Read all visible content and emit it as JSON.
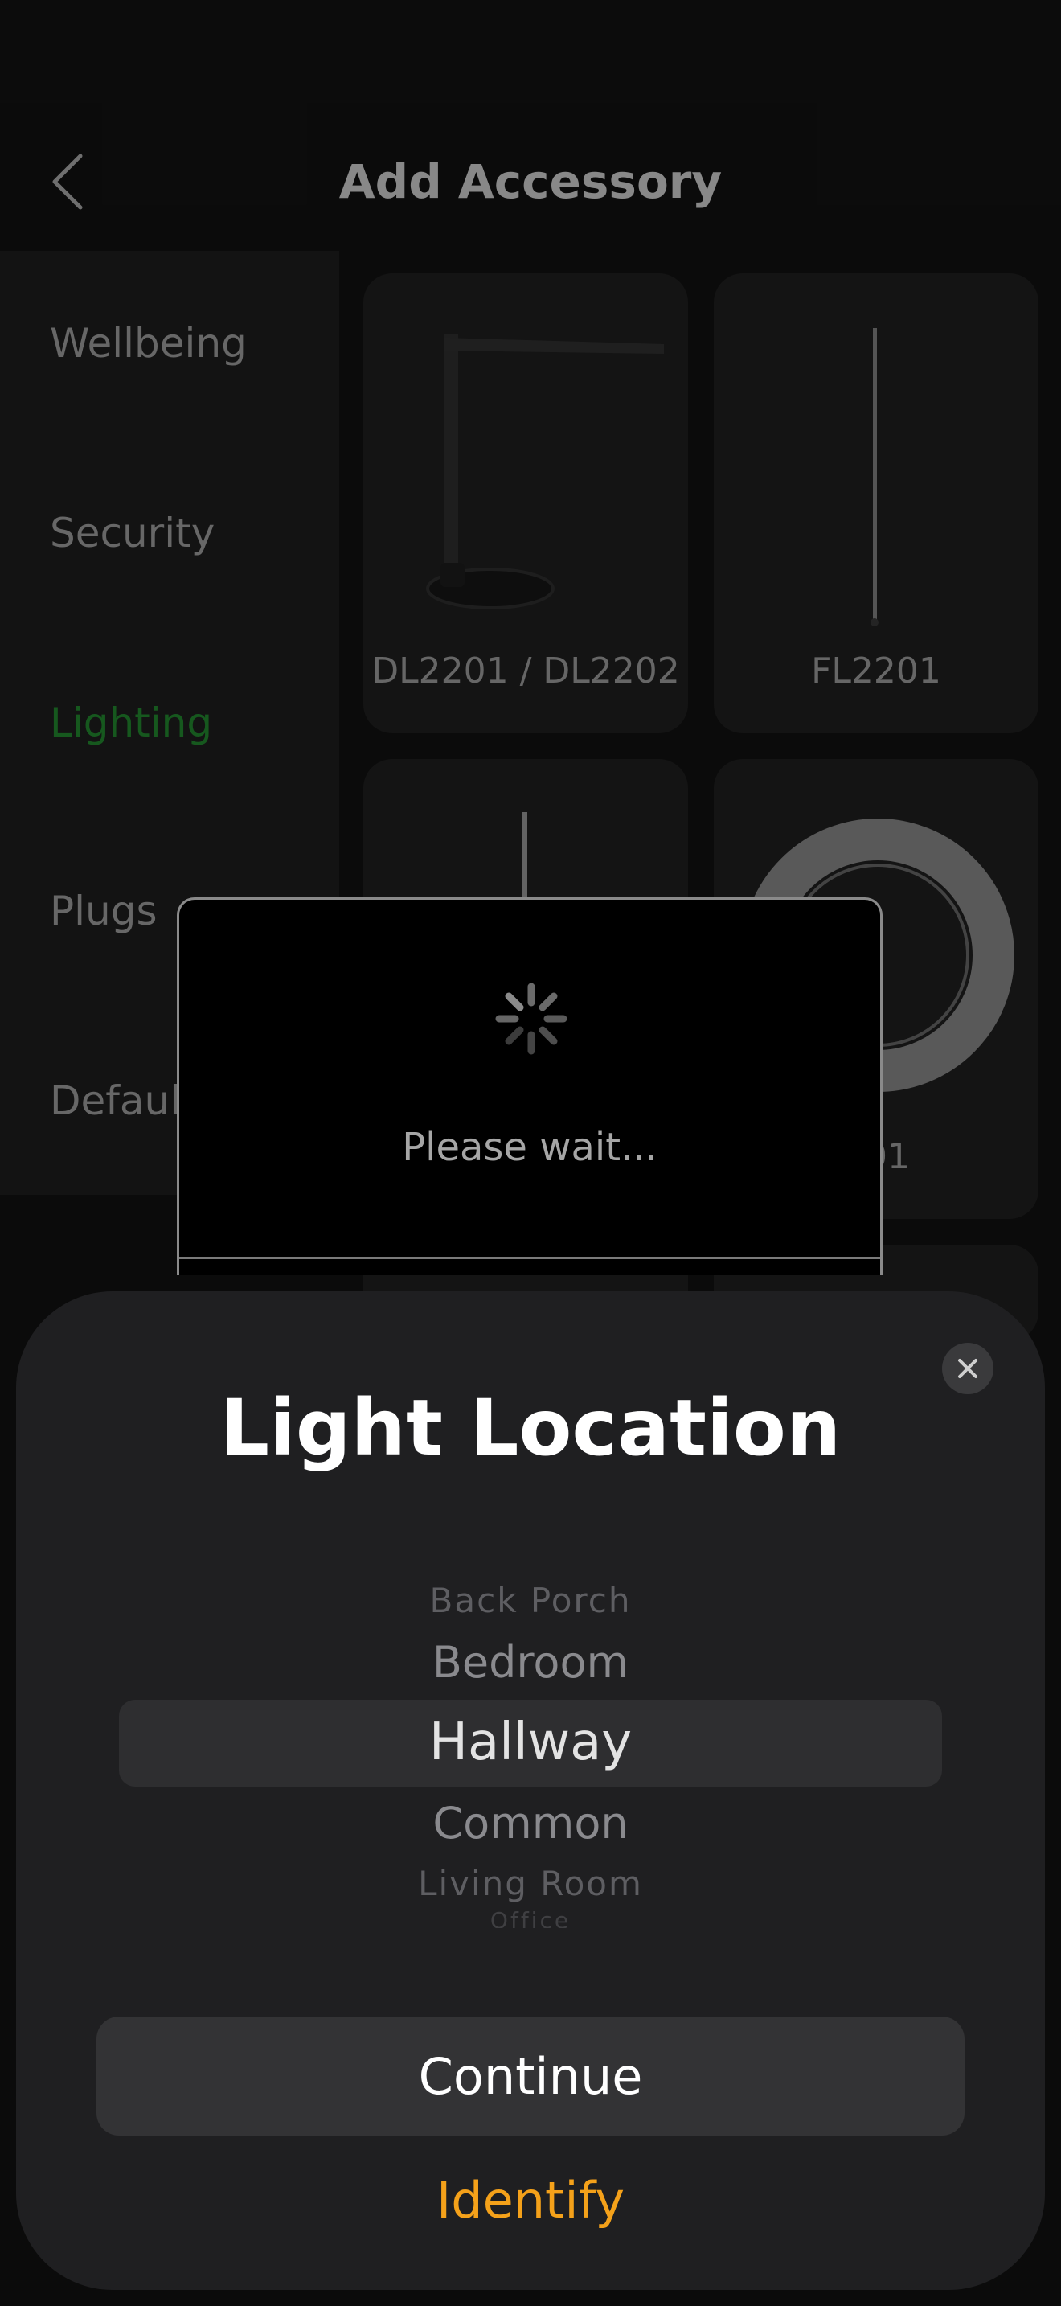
{
  "header": {
    "title": "Add Accessory",
    "back_icon": "chevron-left-icon"
  },
  "sidebar": {
    "items": [
      {
        "label": "Wellbeing",
        "active": false
      },
      {
        "label": "Security",
        "active": false
      },
      {
        "label": "Lighting",
        "active": true
      },
      {
        "label": "Plugs",
        "active": false
      },
      {
        "label": "Default",
        "active": false
      }
    ]
  },
  "products": [
    {
      "label": "DL2201 / DL2202",
      "image": "desk-lamp-image"
    },
    {
      "label": "FL2201",
      "image": "floor-lamp-image"
    },
    {
      "label": "",
      "image": "floor-lamp-image"
    },
    {
      "label": "201",
      "image": "light-strip-image"
    }
  ],
  "wait_dialog": {
    "text": "Please wait...",
    "icon": "spinner-icon"
  },
  "sheet": {
    "title": "Light Location",
    "close_icon": "close-icon",
    "picker": {
      "options": [
        "Back Porch",
        "Bedroom",
        "Hallway",
        "Common",
        "Living Room",
        "Office"
      ],
      "selected": "Hallway"
    },
    "continue_label": "Continue",
    "identify_label": "Identify"
  },
  "colors": {
    "accent_orange": "#f4a11a",
    "active_green": "#1f7a2a",
    "sheet_bg": "#1f1f21"
  }
}
